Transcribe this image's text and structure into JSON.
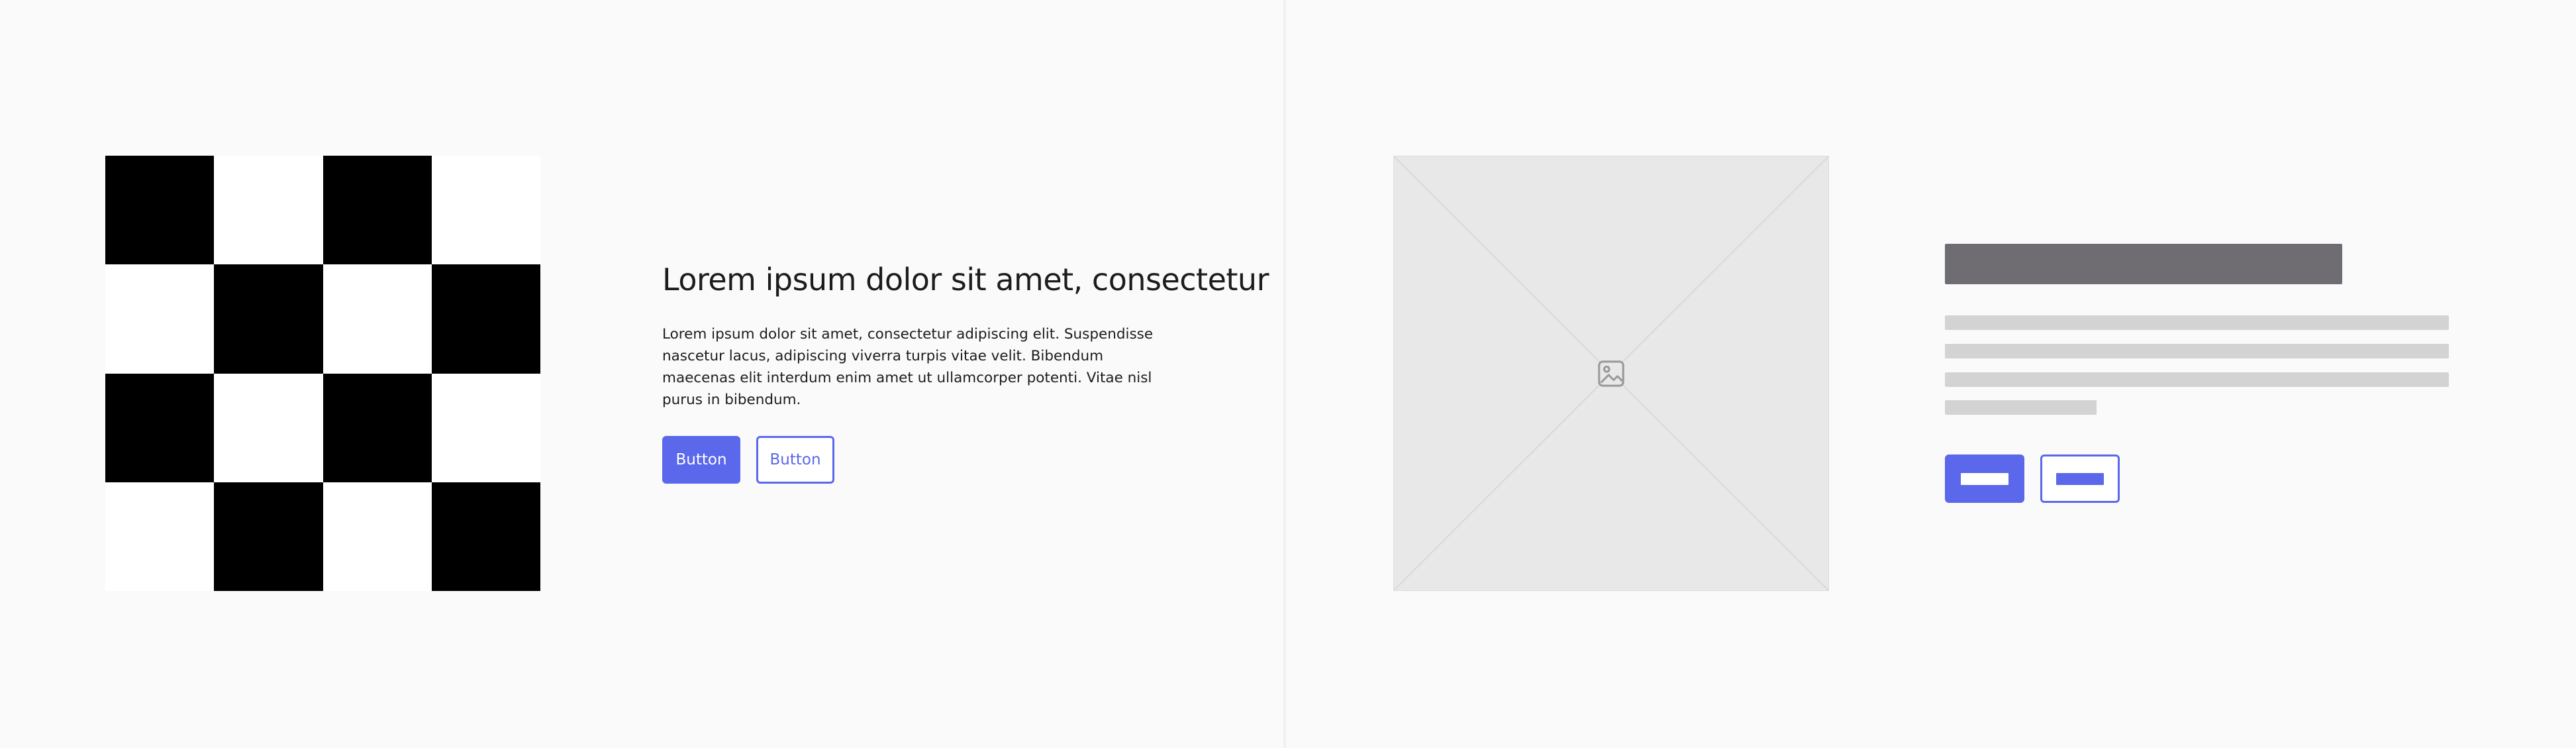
{
  "colors": {
    "accent": "#5b68eb",
    "page_background": "#fafafa",
    "checker_dark": "#000000",
    "checker_light": "#ffffff",
    "placeholder_fill": "#e8e8e8",
    "wireframe_title": "#6f6d72",
    "wireframe_line": "#d3d3d3"
  },
  "left_panel": {
    "image": {
      "type": "checkerboard",
      "grid": "4x4"
    },
    "heading": "Lorem ipsum dolor sit amet, consectetur",
    "body": "Lorem ipsum dolor sit amet, consectetur adipiscing elit. Suspendisse nascetur lacus, adipiscing viverra turpis vitae velit. Bibendum maecenas elit interdum enim amet ut ullamcorper potenti. Vitae nisl purus in bibendum.",
    "primary_button_label": "Button",
    "secondary_button_label": "Button"
  },
  "right_panel": {
    "image_placeholder_icon": "image-icon"
  }
}
